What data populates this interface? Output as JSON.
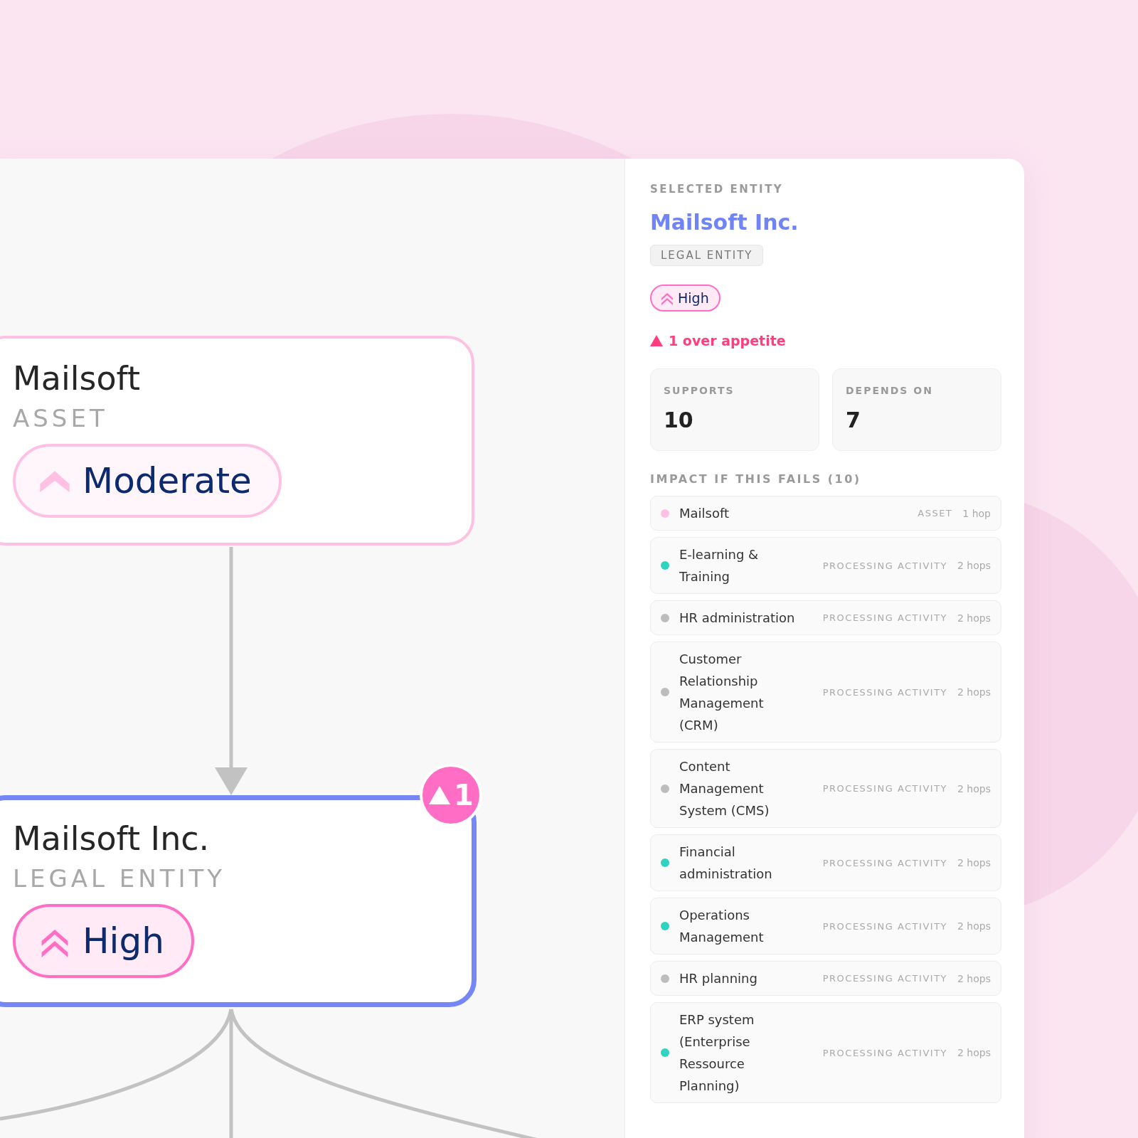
{
  "canvas": {
    "nodes": [
      {
        "title": "Mailsoft",
        "type": "ASSET",
        "risk": {
          "kind": "moderate",
          "label": "Moderate"
        },
        "selected": false
      },
      {
        "title": "Mailsoft Inc.",
        "type": "LEGAL ENTITY",
        "risk": {
          "kind": "high",
          "label": "High"
        },
        "selected": true,
        "alert_badge": "1"
      }
    ]
  },
  "panel": {
    "section_label": "SELECTED ENTITY",
    "title": "Mailsoft Inc.",
    "type_tag": "LEGAL ENTITY",
    "risk": {
      "kind": "high",
      "label": "High"
    },
    "appetite_warning": "1 over appetite",
    "stats": [
      {
        "label": "SUPPORTS",
        "value": "10"
      },
      {
        "label": "DEPENDS ON",
        "value": "7"
      }
    ],
    "impact": {
      "heading": "IMPACT IF THIS FAILS (10)",
      "rows": [
        {
          "name": "Mailsoft",
          "type": "ASSET",
          "hops": "1 hop",
          "color": "#ffc1e3"
        },
        {
          "name": "E-learning & Training",
          "type": "PROCESSING ACTIVITY",
          "hops": "2 hops",
          "color": "#2fd3c0"
        },
        {
          "name": "HR administration",
          "type": "PROCESSING ACTIVITY",
          "hops": "2 hops",
          "color": "#bdbdbd"
        },
        {
          "name": "Customer Relationship Management (CRM)",
          "type": "PROCESSING ACTIVITY",
          "hops": "2 hops",
          "color": "#bdbdbd"
        },
        {
          "name": "Content Management System (CMS)",
          "type": "PROCESSING ACTIVITY",
          "hops": "2 hops",
          "color": "#bdbdbd"
        },
        {
          "name": "Financial administration",
          "type": "PROCESSING ACTIVITY",
          "hops": "2 hops",
          "color": "#2fd3c0"
        },
        {
          "name": "Operations Management",
          "type": "PROCESSING ACTIVITY",
          "hops": "2 hops",
          "color": "#2fd3c0"
        },
        {
          "name": "HR planning",
          "type": "PROCESSING ACTIVITY",
          "hops": "2 hops",
          "color": "#bdbdbd"
        },
        {
          "name": "ERP system (Enterprise Ressource Planning)",
          "type": "PROCESSING ACTIVITY",
          "hops": "2 hops",
          "color": "#2fd3c0"
        }
      ]
    }
  }
}
